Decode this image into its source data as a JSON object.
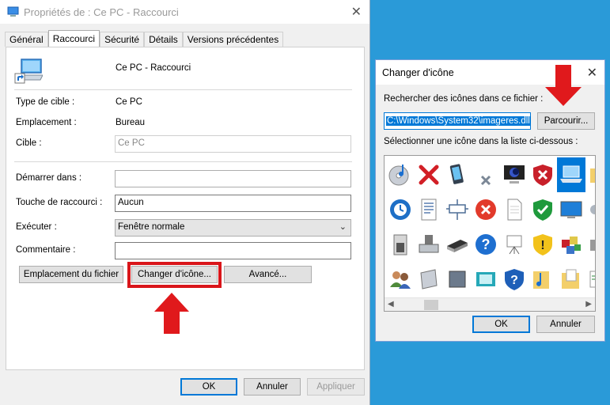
{
  "properties_window": {
    "title": "Propriétés de : Ce PC - Raccourci",
    "tabs": [
      "Général",
      "Raccourci",
      "Sécurité",
      "Détails",
      "Versions précédentes"
    ],
    "active_tab": "Raccourci",
    "shortcut_name": "Ce PC - Raccourci",
    "rows": {
      "target_type_label": "Type de cible :",
      "target_type_value": "Ce PC",
      "location_label": "Emplacement :",
      "location_value": "Bureau",
      "target_label": "Cible :",
      "target_value": "Ce PC",
      "start_in_label": "Démarrer dans :",
      "start_in_value": "",
      "shortcut_key_label": "Touche de raccourci :",
      "shortcut_key_value": "Aucun",
      "run_label": "Exécuter :",
      "run_value": "Fenêtre normale",
      "comment_label": "Commentaire :",
      "comment_value": ""
    },
    "buttons": {
      "file_location": "Emplacement du fichier",
      "change_icon": "Changer d'icône...",
      "advanced": "Avancé...",
      "ok": "OK",
      "cancel": "Annuler",
      "apply": "Appliquer"
    }
  },
  "change_icon_dialog": {
    "title": "Changer d'icône",
    "search_label": "Rechercher des icônes dans ce fichier :",
    "path_value": "C:\\Windows\\System32\\imageres.dll",
    "browse_button": "Parcourir...",
    "select_label": "Sélectionner une icône dans la liste ci-dessous :",
    "icons": [
      "cd-music-icon",
      "red-x-icon",
      "mobile-device-icon",
      "small-x-icon",
      "monitor-screensaver-icon",
      "shield-red-icon",
      "laptop-icon",
      "folder-partial-icon",
      "sync-clock-icon",
      "document-text-icon",
      "network-box-icon",
      "red-circle-x-icon",
      "blank-page-icon",
      "shield-green-check-icon",
      "display-blue-icon",
      "gear-partial-icon",
      "server-tower-icon",
      "printer-device-icon",
      "scanner-icon",
      "help-circle-icon",
      "presentation-board-icon",
      "shield-warning-icon",
      "programs-blocks-icon",
      "small-partial-icon",
      "users-icon",
      "drive-slanted-icon",
      "disk-tray-icon",
      "display-settings-icon",
      "shield-help-icon",
      "music-folder-icon",
      "folder-documents-icon",
      "sheet-partial-icon"
    ],
    "selected_icon": "laptop-icon",
    "ok_button": "OK",
    "cancel_button": "Annuler"
  },
  "colors": {
    "desktop_background": "#2a9ad8",
    "selection_blue": "#0078d7",
    "annotation_red": "#d9151a"
  }
}
